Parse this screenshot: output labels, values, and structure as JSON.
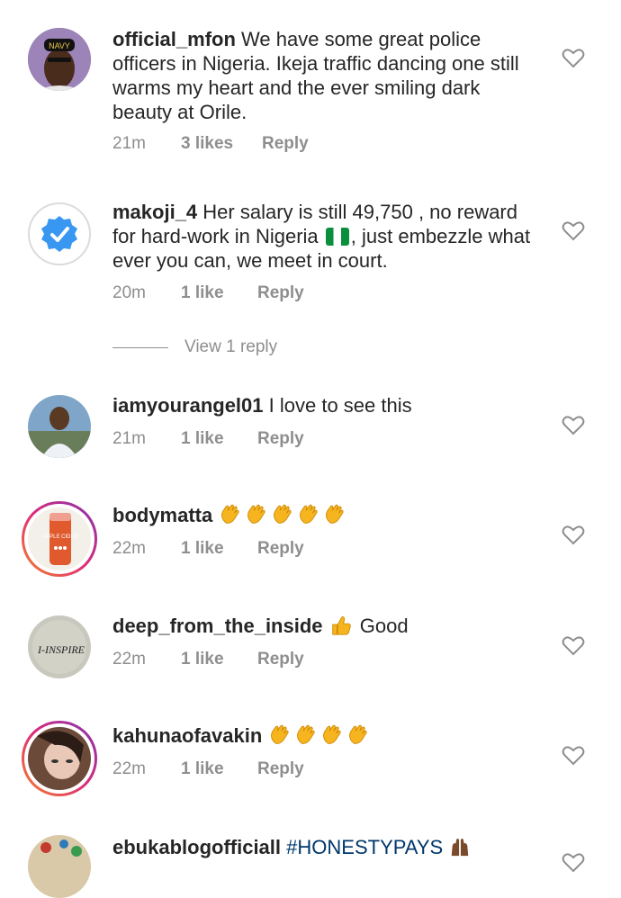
{
  "comments": [
    {
      "username": "official_mfon",
      "text": "We have some great police officers in Nigeria.  Ikeja traffic dancing one still warms my heart and the ever smiling dark beauty at Orile.",
      "time": "21m",
      "likes": "3 likes",
      "reply": "Reply",
      "avatar_badge": "NAVY"
    },
    {
      "username": "makoji_4",
      "text_before_flag": "Her salary is still 49,750 , no reward for hard-work in Nigeria",
      "text_after_flag": ", just embezzle what ever you can, we meet in court.",
      "time": "20m",
      "likes": "1 like",
      "reply": "Reply",
      "view_replies": "View 1 reply"
    },
    {
      "username": "iamyourangel01",
      "text": "I love to see this",
      "time": "21m",
      "likes": "1 like",
      "reply": "Reply"
    },
    {
      "username": "bodymatta",
      "time": "22m",
      "likes": "1 like",
      "reply": "Reply",
      "avatar_label": "APPLE CIDER"
    },
    {
      "username": "deep_from_the_inside",
      "text": "Good",
      "time": "22m",
      "likes": "1 like",
      "reply": "Reply",
      "avatar_label": "I-INSPIRE"
    },
    {
      "username": "kahunaofavakin",
      "time": "22m",
      "likes": "1 like",
      "reply": "Reply"
    },
    {
      "username": "ebukablogofficiall",
      "text": "#HONESTYPAYS"
    }
  ],
  "colors": {
    "text": "#262626",
    "meta": "#8e8e8e",
    "hashtag": "#00376b",
    "verified": "#3897f0",
    "clap": "#f6b51e"
  }
}
